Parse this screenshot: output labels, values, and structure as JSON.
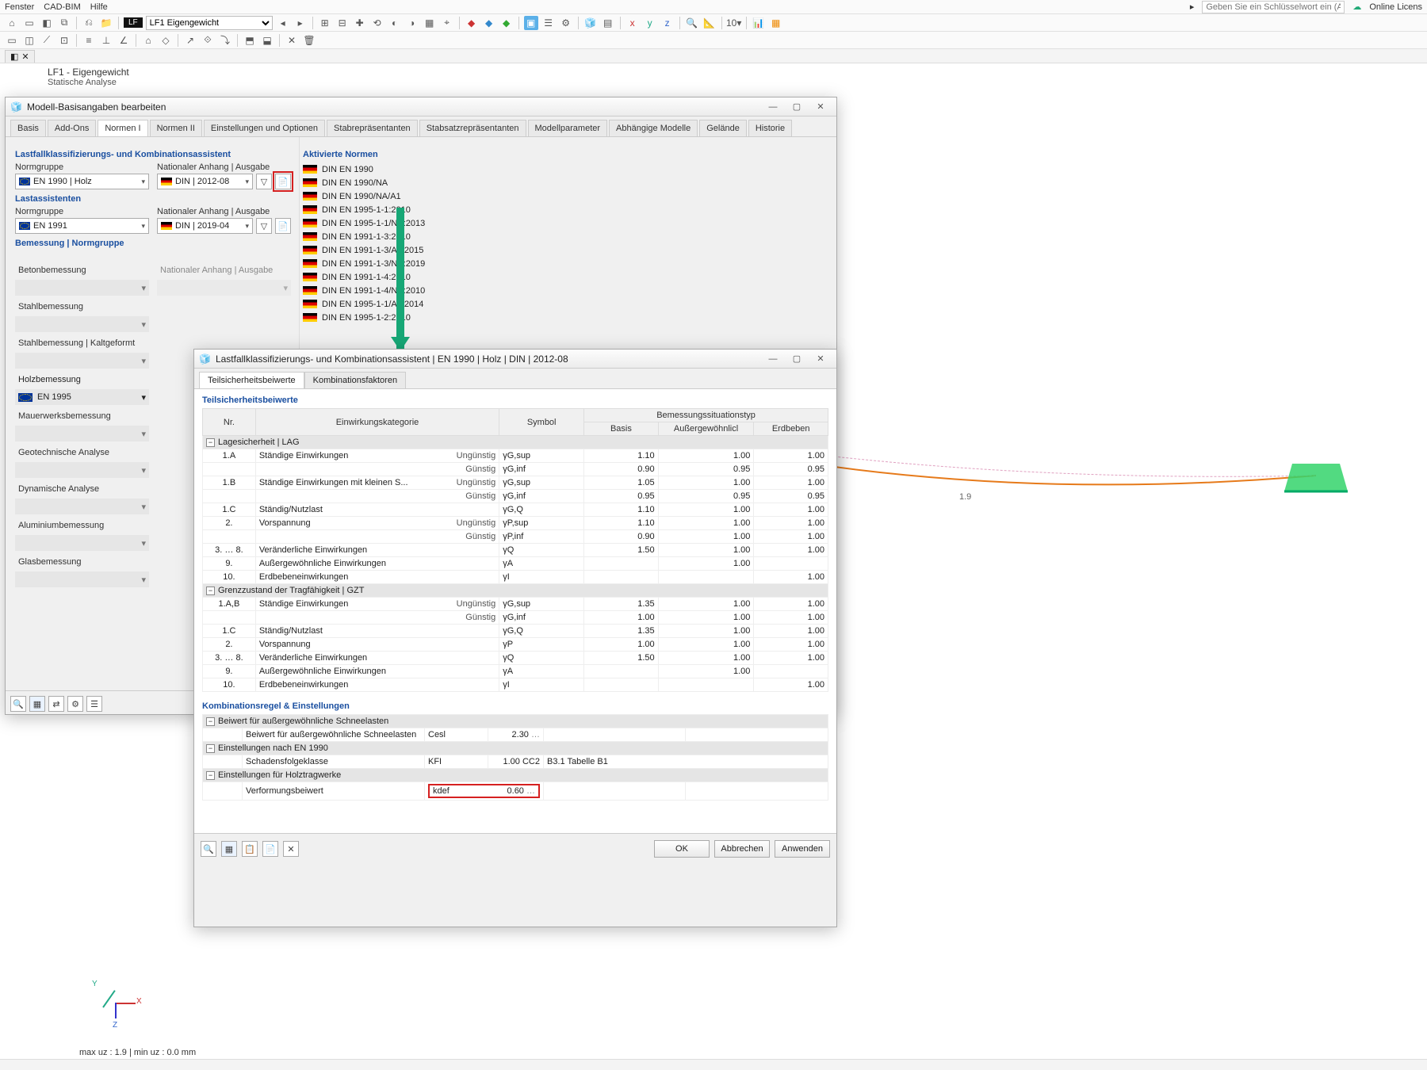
{
  "menu": {
    "items": [
      "Fenster",
      "CAD-BIM",
      "Hilfe"
    ],
    "keyword_placeholder": "Geben Sie ein Schlüsselwort ein (Alt+Q)",
    "license": "Online Licens"
  },
  "toolbar2": {
    "lf_badge": "LF",
    "lf_combo": "LF1    Eigengewicht"
  },
  "doc": {
    "line1": "LF1 - Eigengewicht",
    "line2": "Statische Analyse"
  },
  "dlg1": {
    "title": "Modell-Basisangaben bearbeiten",
    "tabs": [
      "Basis",
      "Add-Ons",
      "Normen I",
      "Normen II",
      "Einstellungen und Optionen",
      "Stabrepräsentanten",
      "Stabsatzrepräsentanten",
      "Modellparameter",
      "Abhängige Modelle",
      "Gelände",
      "Historie"
    ],
    "active_tab": 2,
    "section1_title": "Lastfallklassifizierungs- und Kombinationsassistent",
    "normgruppe_lbl": "Normgruppe",
    "nat_anhang_lbl": "Nationaler Anhang | Ausgabe",
    "normgruppe1": "EN 1990 | Holz",
    "din1": "DIN | 2012-08",
    "section2_title": "Lastassistenten",
    "normgruppe2": "EN 1991",
    "din2": "DIN | 2019-04",
    "section3_title": "Bemessung | Normgruppe",
    "beton_lbl": "Betonbemessung",
    "stahl_lbl": "Stahlbemessung",
    "stahlk_lbl": "Stahlbemessung | Kaltgeformt",
    "holz_lbl": "Holzbemessung",
    "holz_val": "EN 1995",
    "mauer_lbl": "Mauerwerksbemessung",
    "geo_lbl": "Geotechnische Analyse",
    "dyn_lbl": "Dynamische Analyse",
    "alu_lbl": "Aluminiumbemessung",
    "glas_lbl": "Glasbemessung",
    "akt_title": "Aktivierte Normen",
    "akt_list": [
      "DIN EN 1990",
      "DIN EN 1990/NA",
      "DIN EN 1990/NA/A1",
      "DIN EN 1995-1-1:2010",
      "DIN EN 1995-1-1/NA:2013",
      "DIN EN 1991-1-3:2010",
      "DIN EN 1991-1-3/A1:2015",
      "DIN EN 1991-1-3/NA:2019",
      "DIN EN 1991-1-4:2010",
      "DIN EN 1991-1-4/NA:2010",
      "DIN EN 1995-1-1/A2:2014",
      "DIN EN 1995-1-2:2010"
    ]
  },
  "dlg2": {
    "title": "Lastfallklassifizierungs- und Kombinationsassistent | EN 1990 | Holz | DIN | 2012-08",
    "tabs": [
      "Teilsicherheitsbeiwerte",
      "Kombinationsfaktoren"
    ],
    "active_tab": 0,
    "sec_title": "Teilsicherheitsbeiwerte",
    "hdr_nr": "Nr.",
    "hdr_kat": "Einwirkungskategorie",
    "hdr_sym": "Symbol",
    "hdr_typ": "Bemessungssituationstyp",
    "hdr_basis": "Basis",
    "hdr_auss": "Außergewöhnlicl",
    "hdr_erd": "Erdbeben",
    "group1": "Lagesicherheit | LAG",
    "rows1": [
      {
        "nr": "1.A",
        "kat": "Ständige Einwirkungen",
        "f": "Ungünstig",
        "sym": "γG,sup",
        "b": "1.10",
        "a": "1.00",
        "e": "1.00"
      },
      {
        "nr": "",
        "kat": "",
        "f": "Günstig",
        "sym": "γG,inf",
        "b": "0.90",
        "a": "0.95",
        "e": "0.95"
      },
      {
        "nr": "1.B",
        "kat": "Ständige Einwirkungen mit kleinen S...",
        "f": "Ungünstig",
        "sym": "γG,sup",
        "b": "1.05",
        "a": "1.00",
        "e": "1.00"
      },
      {
        "nr": "",
        "kat": "",
        "f": "Günstig",
        "sym": "γG,inf",
        "b": "0.95",
        "a": "0.95",
        "e": "0.95"
      },
      {
        "nr": "1.C",
        "kat": "Ständig/Nutzlast",
        "f": "",
        "sym": "γG,Q",
        "b": "1.10",
        "a": "1.00",
        "e": "1.00"
      },
      {
        "nr": "2.",
        "kat": "Vorspannung",
        "f": "Ungünstig",
        "sym": "γP,sup",
        "b": "1.10",
        "a": "1.00",
        "e": "1.00"
      },
      {
        "nr": "",
        "kat": "",
        "f": "Günstig",
        "sym": "γP,inf",
        "b": "0.90",
        "a": "1.00",
        "e": "1.00"
      },
      {
        "nr": "3. … 8.",
        "kat": "Veränderliche Einwirkungen",
        "f": "",
        "sym": "γQ",
        "b": "1.50",
        "a": "1.00",
        "e": "1.00"
      },
      {
        "nr": "9.",
        "kat": "Außergewöhnliche Einwirkungen",
        "f": "",
        "sym": "γA",
        "b": "",
        "a": "1.00",
        "e": ""
      },
      {
        "nr": "10.",
        "kat": "Erdbebeneinwirkungen",
        "f": "",
        "sym": "γI",
        "b": "",
        "a": "",
        "e": "1.00"
      }
    ],
    "group2": "Grenzzustand der Tragfähigkeit | GZT",
    "rows2": [
      {
        "nr": "1.A,B",
        "kat": "Ständige Einwirkungen",
        "f": "Ungünstig",
        "sym": "γG,sup",
        "b": "1.35",
        "a": "1.00",
        "e": "1.00"
      },
      {
        "nr": "",
        "kat": "",
        "f": "Günstig",
        "sym": "γG,inf",
        "b": "1.00",
        "a": "1.00",
        "e": "1.00"
      },
      {
        "nr": "1.C",
        "kat": "Ständig/Nutzlast",
        "f": "",
        "sym": "γG,Q",
        "b": "1.35",
        "a": "1.00",
        "e": "1.00"
      },
      {
        "nr": "2.",
        "kat": "Vorspannung",
        "f": "",
        "sym": "γP",
        "b": "1.00",
        "a": "1.00",
        "e": "1.00"
      },
      {
        "nr": "3. … 8.",
        "kat": "Veränderliche Einwirkungen",
        "f": "",
        "sym": "γQ",
        "b": "1.50",
        "a": "1.00",
        "e": "1.00"
      },
      {
        "nr": "9.",
        "kat": "Außergewöhnliche Einwirkungen",
        "f": "",
        "sym": "γA",
        "b": "",
        "a": "1.00",
        "e": ""
      },
      {
        "nr": "10.",
        "kat": "Erdbebeneinwirkungen",
        "f": "",
        "sym": "γI",
        "b": "",
        "a": "",
        "e": "1.00"
      }
    ],
    "komb_title": "Kombinationsregel & Einstellungen",
    "snow_head": "Beiwert für außergewöhnliche Schneelasten",
    "snow_row_lbl": "Beiwert für außergewöhnliche Schneelasten",
    "snow_sym": "Cesl",
    "snow_val": "2.30",
    "en1990_head": "Einstellungen nach EN 1990",
    "en1990_row_lbl": "Schadensfolgeklasse",
    "en1990_sym": "KFI",
    "en1990_val": "1.00",
    "en1990_cc": "CC2",
    "en1990_ref": "B3.1 Tabelle B1",
    "holz_head": "Einstellungen für Holztragwerke",
    "holz_row_lbl": "Verformungsbeiwert",
    "holz_sym": "kdef",
    "holz_val": "0.60",
    "btn_ok": "OK",
    "btn_cancel": "Abbrechen",
    "btn_apply": "Anwenden"
  },
  "status": "max uz : 1.9 | min uz : 0.0 mm",
  "view": {
    "dim_label": "1.9"
  },
  "gizmo": {
    "x": "X",
    "y": "Y",
    "z": "Z"
  }
}
